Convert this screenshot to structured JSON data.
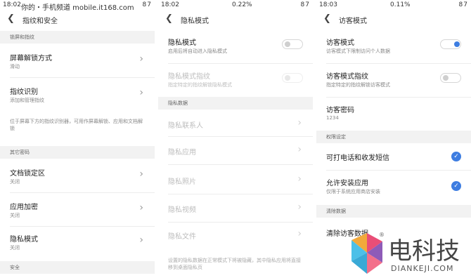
{
  "screen1": {
    "status": {
      "time": "18:02",
      "watermark": "你的・手机频道 mobile.it168.com",
      "icons": "87"
    },
    "title": "指纹和安全",
    "sections": {
      "lock_fp": "锁屏和指纹",
      "other_pwd": "其它密码",
      "security": "安全"
    },
    "items": {
      "lock_method": {
        "label": "屏幕解锁方式",
        "sub": "滑动"
      },
      "fingerprint": {
        "label": "指纹识别",
        "sub": "添加和管理指纹"
      }
    },
    "note": "位于屏幕下方的指纹识别器，可用作屏幕解锁、应用和文档解锁",
    "pwd_items": {
      "doc_lock": {
        "label": "文档锁定区",
        "sub": "关闭"
      },
      "app_encrypt": {
        "label": "应用加密",
        "sub": "关闭"
      },
      "privacy_mode": {
        "label": "隐私模式",
        "sub": "关闭"
      }
    }
  },
  "screen2": {
    "status": {
      "time": "18:02",
      "speed": "0.22%",
      "icons": "87"
    },
    "title": "隐私模式",
    "items": {
      "privacy_mode": {
        "label": "隐私模式",
        "sub": "启用后将自动进入隐私模式"
      },
      "privacy_fp": {
        "label": "隐私模式指纹",
        "sub": "指定特定的指纹解锁隐私模式"
      }
    },
    "section": "隐私数据",
    "data_items": [
      "隐私联系人",
      "隐私应用",
      "隐私照片",
      "隐私视频",
      "隐私文件"
    ],
    "note": "设置的隐私数据在正常模式下将被隐藏，其中隐私应用将直接移到桌面隐私页"
  },
  "screen3": {
    "status": {
      "time": "18:03",
      "speed": "0.11%",
      "icons": "87"
    },
    "title": "访客模式",
    "items": {
      "guest_mode": {
        "label": "访客模式",
        "sub": "访客模式下限制访问个人数据"
      },
      "guest_fp": {
        "label": "访客模式指纹",
        "sub": "指定特定的指纹解锁访客模式"
      },
      "guest_pwd": {
        "label": "访客密码",
        "sub": "1234"
      }
    },
    "perm_section": "权限设定",
    "perms": {
      "calls": {
        "label": "可打电话和收发短信"
      },
      "install": {
        "label": "允许安装应用",
        "sub": "仅限于系统应用商店安装"
      }
    },
    "clear_section": "清除数据",
    "clear_label": "清除访客数据"
  },
  "logo": {
    "text": "电科技",
    "sub": "DIANKEJI.COM",
    "reg": "®"
  },
  "colors": {
    "accent": "#3d7de1",
    "section_bg": "#f2f2f2"
  }
}
